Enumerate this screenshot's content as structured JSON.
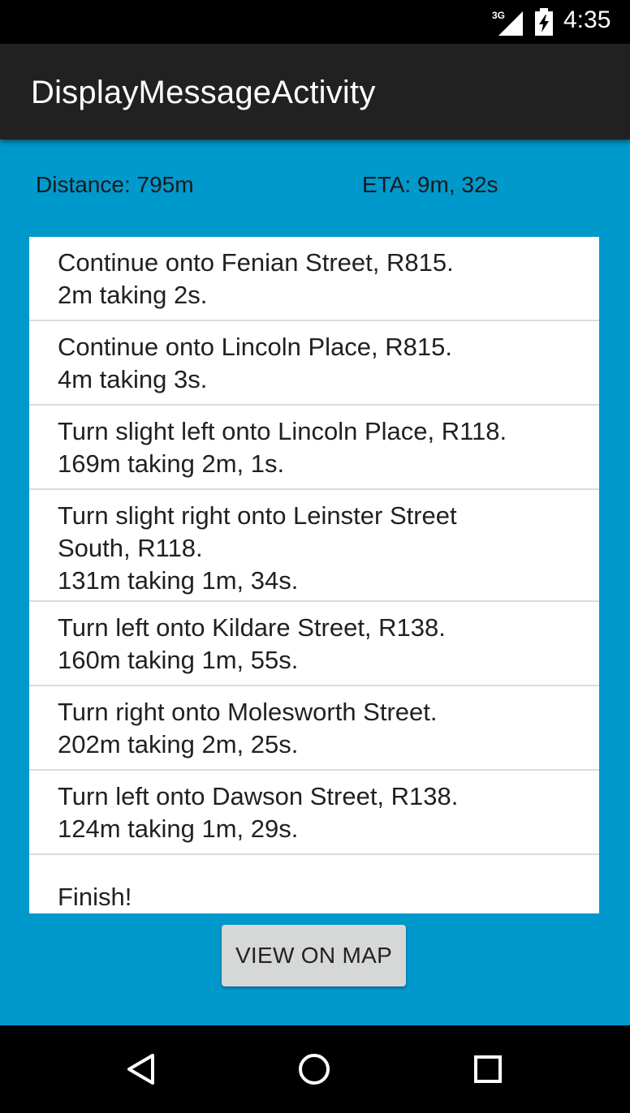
{
  "status_bar": {
    "network_label": "3G",
    "time": "4:35",
    "icons": [
      "signal-icon",
      "battery-charging-icon"
    ]
  },
  "app_bar": {
    "title": "DisplayMessageActivity"
  },
  "summary": {
    "distance": "Distance: 795m",
    "eta": "ETA: 9m, 32s"
  },
  "directions": [
    {
      "text": "Continue onto Fenian Street, R815.\n2m taking 2s."
    },
    {
      "text": "Continue onto Lincoln Place, R815.\n4m taking 3s."
    },
    {
      "text": "Turn slight left onto Lincoln Place, R118.\n169m taking 2m, 1s."
    },
    {
      "text": "Turn slight right onto Leinster Street\nSouth, R118.\n131m taking 1m, 34s."
    },
    {
      "text": "Turn left onto Kildare Street, R138.\n160m taking 1m, 55s."
    },
    {
      "text": "Turn right onto Molesworth Street.\n202m taking 2m, 25s."
    },
    {
      "text": "Turn left onto Dawson Street, R138.\n124m taking 1m, 29s."
    },
    {
      "text": "Finish!"
    }
  ],
  "actions": {
    "view_on_map": "VIEW ON MAP"
  },
  "nav_bar": {
    "icons": [
      "back-icon",
      "home-icon",
      "recents-icon"
    ]
  },
  "colors": {
    "content_background": "#0099cc",
    "app_bar": "#212121",
    "button": "#d6d7d7"
  }
}
